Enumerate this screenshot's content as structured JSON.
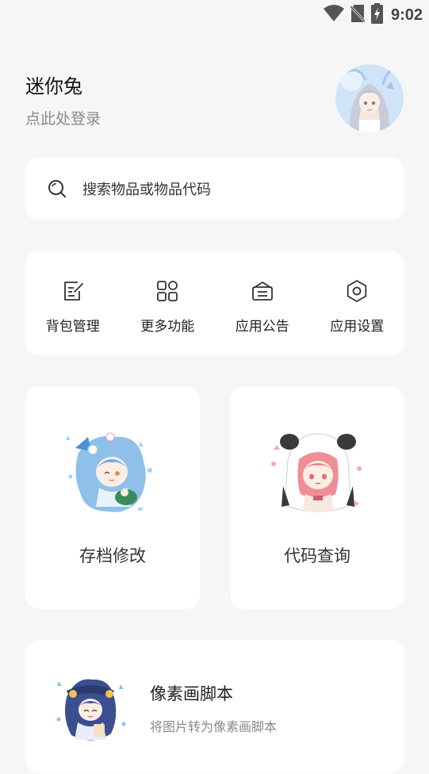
{
  "status_bar": {
    "time": "9:02",
    "icons": [
      "wifi-icon",
      "no-sim-icon",
      "battery-charging-icon"
    ]
  },
  "header": {
    "username": "迷你兔",
    "login_hint": "点此处登录",
    "avatar_icon": "anime-avatar"
  },
  "search": {
    "icon": "search-icon",
    "placeholder": "搜索物品或物品代码"
  },
  "quick_actions": [
    {
      "label": "背包管理",
      "icon": "edit-note-icon"
    },
    {
      "label": "更多功能",
      "icon": "grid-apps-icon"
    },
    {
      "label": "应用公告",
      "icon": "announcement-inbox-icon"
    },
    {
      "label": "应用设置",
      "icon": "hexagon-settings-icon"
    }
  ],
  "feature_cards": [
    {
      "label": "存档修改",
      "art": "chibi-blue-hair-illustration"
    },
    {
      "label": "代码查询",
      "art": "chibi-panda-hood-illustration"
    }
  ],
  "pixel_card": {
    "title": "像素画脚本",
    "subtitle": "将图片转为像素画脚本",
    "art": "chibi-witch-illustration"
  },
  "colors": {
    "background": "#f6f6f6",
    "card": "#ffffff",
    "text_primary": "#222222",
    "text_secondary": "#8a8a8a"
  }
}
